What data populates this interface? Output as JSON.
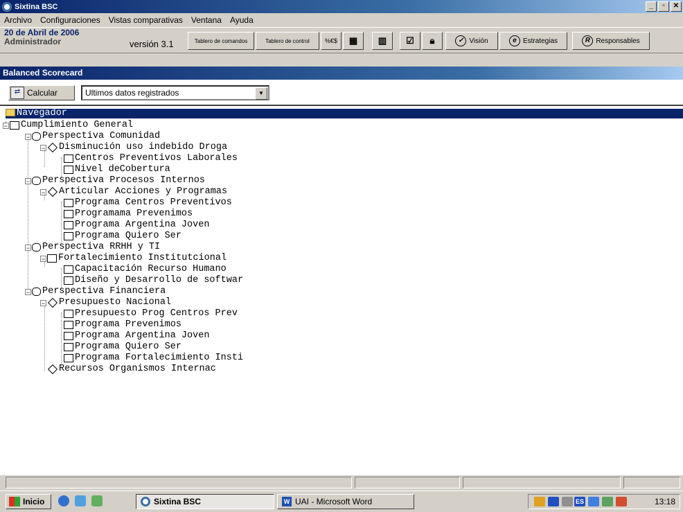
{
  "window": {
    "title": "Sixtina BSC"
  },
  "menu": [
    "Archivo",
    "Configuraciones",
    "Vistas comparativas",
    "Ventana",
    "Ayuda"
  ],
  "toolbar": {
    "date": "20 de Abril de 2006",
    "user": "Administrador",
    "version": "versión 3.1",
    "btn_tablero_comandos": "Tablero de comandos",
    "btn_tablero_control": "Tablero de control",
    "btn_currency": "%€$",
    "btn_vision": "Visión",
    "btn_estrategias": "Estrategias",
    "btn_responsables": "Responsables"
  },
  "panel": {
    "title": "Balanced Scorecard"
  },
  "actions": {
    "calcular": "Calcular",
    "data_select": "Ultimos datos registrados"
  },
  "tree": {
    "root": "Navegador",
    "items": [
      "Cumplimiento General",
      "Perspectiva Comunidad",
      "Disminución uso indebido Droga",
      "Centros Preventivos Laborales",
      "Nivel deCobertura",
      "Perspectiva Procesos Internos",
      "Articular Acciones y Programas",
      "Programa Centros Preventivos",
      "Programama Prevenimos",
      "Programa Argentina Joven",
      "Programa Quiero Ser",
      "Perspectiva RRHH y TI",
      "Fortalecimiento Institutcional",
      "Capacitación Recurso Humano",
      "Diseño y Desarrollo de softwar",
      "Perspectiva Financiera",
      "Presupuesto Nacional",
      "Presupuesto Prog Centros Prev",
      "Programa Prevenimos",
      "Programa Argentina Joven",
      "Programa Quiero Ser",
      "Programa Fortalecimiento Insti",
      "Recursos Organismos  Internac"
    ]
  },
  "taskbar": {
    "start": "Inicio",
    "task1": "Sixtina BSC",
    "task2": "UAI - Microsoft Word",
    "lang": "ES",
    "clock": "13:18"
  }
}
